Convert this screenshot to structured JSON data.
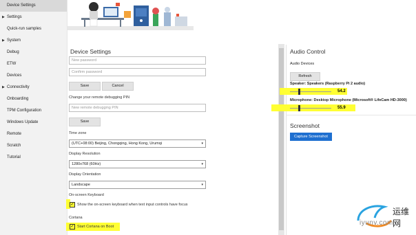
{
  "sidebar": {
    "items": [
      {
        "label": "Device Settings",
        "active": true,
        "caret": false
      },
      {
        "label": "Settings",
        "active": false,
        "caret": true
      },
      {
        "label": "Quick-run samples",
        "active": false,
        "caret": false
      },
      {
        "label": "System",
        "active": false,
        "caret": true
      },
      {
        "label": "Debug",
        "active": false,
        "caret": false
      },
      {
        "label": "ETW",
        "active": false,
        "caret": false
      },
      {
        "label": "Devices",
        "active": false,
        "caret": false
      },
      {
        "label": "Connectivity",
        "active": false,
        "caret": true
      },
      {
        "label": "Onboarding",
        "active": false,
        "caret": false
      },
      {
        "label": "TPM Configuration",
        "active": false,
        "caret": false
      },
      {
        "label": "Windows Update",
        "active": false,
        "caret": false
      },
      {
        "label": "Remote",
        "active": false,
        "caret": false
      },
      {
        "label": "Scratch",
        "active": false,
        "caret": false
      },
      {
        "label": "Tutorial",
        "active": false,
        "caret": false
      }
    ],
    "caret_glyph": "▶"
  },
  "settings": {
    "title": "Device Settings",
    "new_password_placeholder": "New password",
    "confirm_password_placeholder": "Confirm password",
    "save_label": "Save",
    "cancel_label": "Cancel",
    "debug_pin_label": "Change your remote debugging PIN",
    "debug_pin_placeholder": "New remote debugging PIN",
    "save2_label": "Save",
    "timezone_label": "Time zone",
    "timezone_value": "(UTC+08:00) Beijing, Chongqing, Hong Kong, Urumqi",
    "resolution_label": "Display Resolution",
    "resolution_value": "1280x768 (60Hz)",
    "orientation_label": "Display Orientation",
    "orientation_value": "Landscape",
    "keyboard_heading": "On-screen Keyboard",
    "keyboard_checkbox_label": "Show the on-screen keyboard when text input controls have focus",
    "cortana_heading": "Cortana",
    "cortana_checkbox_label": "Start Cortana on Boot",
    "dropdown_arrow": "▾",
    "check_glyph": "✓"
  },
  "audio": {
    "title": "Audio Control",
    "devices_label": "Audio Devices",
    "refresh_label": "Refresh",
    "speaker_label": "Speaker: Speakers (Raspberry Pi 2 audio)",
    "speaker_value": "54.2",
    "speaker_level": 0.2,
    "microphone_label": "Microphone: Desktop Microphone (Microsoft® LifeCam HD-3000)",
    "microphone_value": "55.9",
    "microphone_level": 0.2
  },
  "screenshot": {
    "title": "Screenshot",
    "capture_label": "Capture Screenshot"
  },
  "watermark": {
    "chinese": "运维网",
    "url": "iyunv.com"
  },
  "colors": {
    "highlight": "#ffff33",
    "accent": "#1e6fd0",
    "sidebar_bg": "#f2f2f2"
  }
}
